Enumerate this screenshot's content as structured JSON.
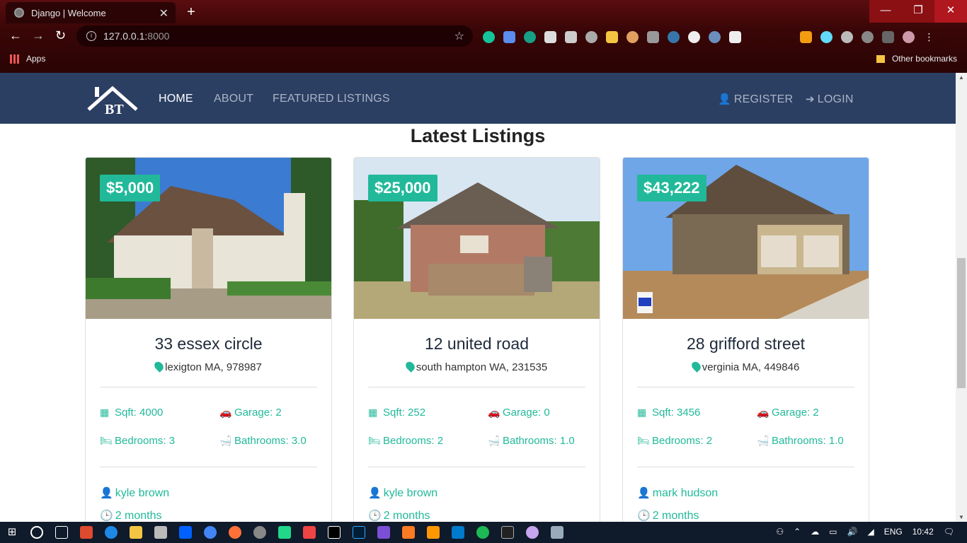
{
  "browser": {
    "tab_title": "Django | Welcome",
    "new_tab": "+",
    "url_host": "127.0.0.1:",
    "url_port": "8000",
    "bookmarks_apps": "Apps",
    "bookmarks_other": "Other bookmarks",
    "window_controls": {
      "minimize": "—",
      "restore": "❐",
      "close": "✕"
    }
  },
  "navbar": {
    "logo_text": "BT",
    "links": [
      "HOME",
      "ABOUT",
      "FEATURED LISTINGS"
    ],
    "register": "REGISTER",
    "login": "LOGIN"
  },
  "section": {
    "title": "Latest Listings"
  },
  "listings": [
    {
      "price": "$5,000",
      "address": "33 essex circle",
      "location": "lexigton MA, 978987",
      "sqft": "Sqft: 4000",
      "garage": "Garage: 2",
      "bedrooms": "Bedrooms: 3",
      "bathrooms": "Bathrooms: 3.0",
      "realtor": "kyle brown",
      "age": "2 months"
    },
    {
      "price": "$25,000",
      "address": "12 united road",
      "location": "south hampton WA, 231535",
      "sqft": "Sqft: 252",
      "garage": "Garage: 0",
      "bedrooms": "Bedrooms: 2",
      "bathrooms": "Bathrooms: 1.0",
      "realtor": "kyle brown",
      "age": "2 months"
    },
    {
      "price": "$43,222",
      "address": "28 grifford street",
      "location": "verginia MA, 449846",
      "sqft": "Sqft: 3456",
      "garage": "Garage: 2",
      "bedrooms": "Bedrooms: 2",
      "bathrooms": "Bathrooms: 1.0",
      "realtor": "mark hudson",
      "age": "2 months"
    }
  ],
  "taskbar": {
    "lang": "ENG",
    "time": "10:42"
  },
  "colors": {
    "accent": "#21b99a",
    "navbar": "#2b3f63"
  }
}
